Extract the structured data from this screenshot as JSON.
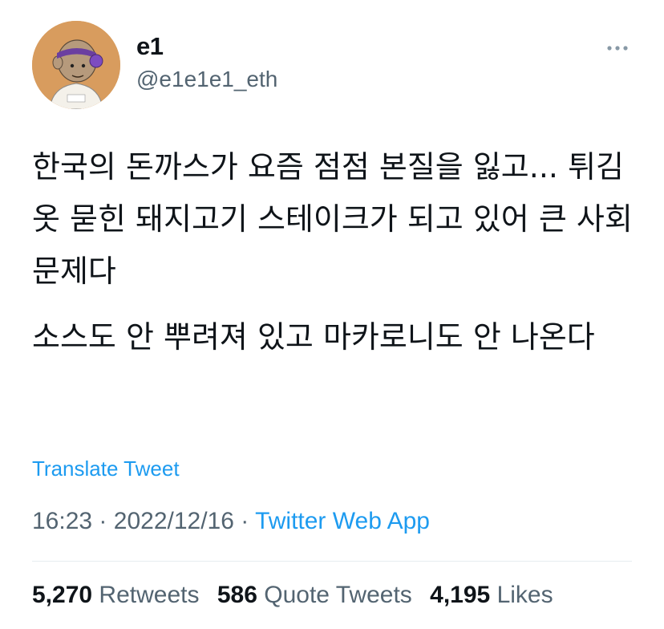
{
  "author": {
    "display_name": "e1",
    "handle": "@e1e1e1_eth",
    "avatar_icon": "cartoon-avatar-icon"
  },
  "more_icon": "ellipsis-icon",
  "tweet": {
    "paragraph1": "한국의 돈까스가 요즘 점점 본질을 잃고... 튀김옷 묻힌 돼지고기 스테이크가 되고 있어 큰 사회 문제다",
    "paragraph2": "소스도 안 뿌려져 있고 마카로니도 안 나온다"
  },
  "translate_label": "Translate Tweet",
  "meta": {
    "time": "16:23",
    "separator": "·",
    "date": "2022/12/16",
    "source": "Twitter Web App"
  },
  "stats": {
    "retweets_count": "5,270",
    "retweets_label": "Retweets",
    "quotes_count": "586",
    "quotes_label": "Quote Tweets",
    "likes_count": "4,195",
    "likes_label": "Likes"
  },
  "colors": {
    "link": "#1d9bf0",
    "secondary_text": "#536471",
    "primary_text": "#0f1419",
    "avatar_bg": "#d89c5e"
  }
}
